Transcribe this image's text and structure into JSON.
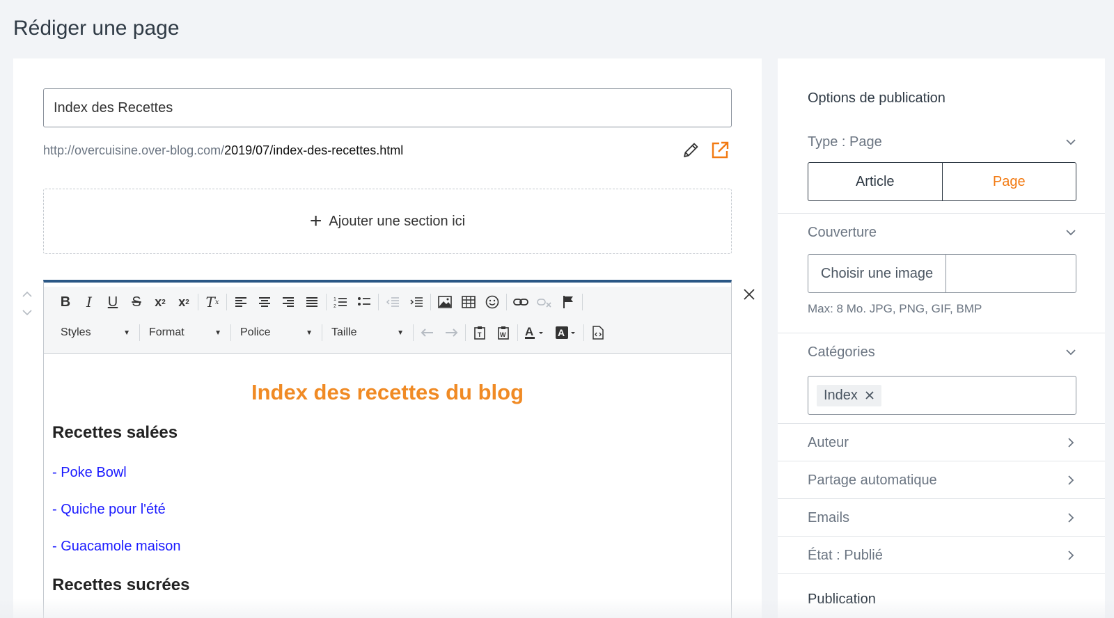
{
  "page": {
    "title": "Rédiger une page"
  },
  "editor": {
    "title_value": "Index des Recettes",
    "url_base": "http://overcuisine.over-blog.com/",
    "url_slug": "2019/07/index-des-recettes.html",
    "add_section_label": "Ajouter une section ici",
    "toolbar": {
      "styles_label": "Styles",
      "format_label": "Format",
      "police_label": "Police",
      "taille_label": "Taille"
    },
    "content": {
      "heading": "Index des recettes du blog",
      "section_salees": "Recettes salées",
      "links": [
        "- Poke Bowl",
        "- Quiche pour l'été",
        "- Guacamole maison"
      ],
      "section_sucrees": "Recettes sucrées"
    }
  },
  "sidebar": {
    "title": "Options de publication",
    "type_label": "Type : Page",
    "type_options": {
      "article": "Article",
      "page": "Page"
    },
    "type_selected": "Page",
    "couverture_label": "Couverture",
    "choose_image_label": "Choisir une image",
    "image_hint": "Max: 8 Mo. JPG, PNG, GIF, BMP",
    "categories_label": "Catégories",
    "category_tag": "Index",
    "auteur_label": "Auteur",
    "partage_label": "Partage automatique",
    "emails_label": "Emails",
    "etat_label": "État : Publié",
    "publication_label": "Publication"
  },
  "colors": {
    "accent": "#f27a12",
    "editor_border": "#2a5785",
    "link": "#1a1aff"
  }
}
